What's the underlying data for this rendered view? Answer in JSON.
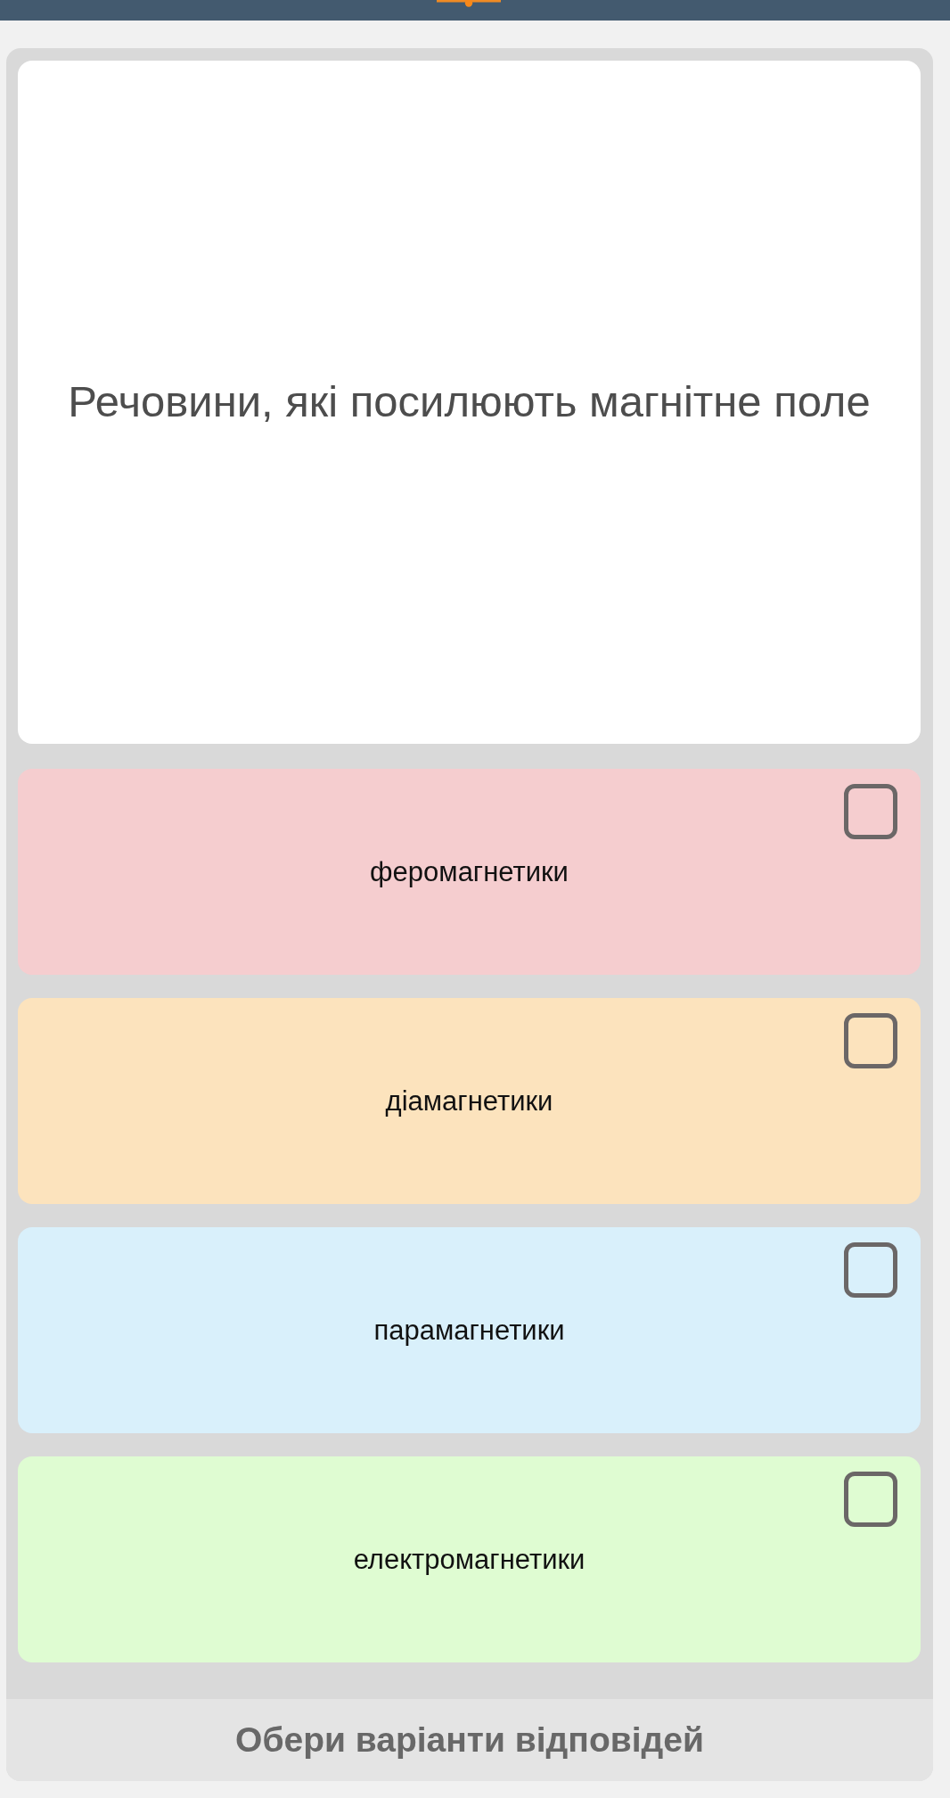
{
  "question": {
    "text": "Речовини, які посилюють магнітне поле"
  },
  "options": [
    {
      "label": "феромагнетики",
      "checked": false,
      "color": "#f5cdcf"
    },
    {
      "label": "діамагнетики",
      "checked": false,
      "color": "#fce3bd"
    },
    {
      "label": "парамагнетики",
      "checked": false,
      "color": "#d9f0fb"
    },
    {
      "label": "електромагнетики",
      "checked": false,
      "color": "#dffcd2"
    }
  ],
  "footer": {
    "prompt": "Обери варіанти відповідей"
  }
}
